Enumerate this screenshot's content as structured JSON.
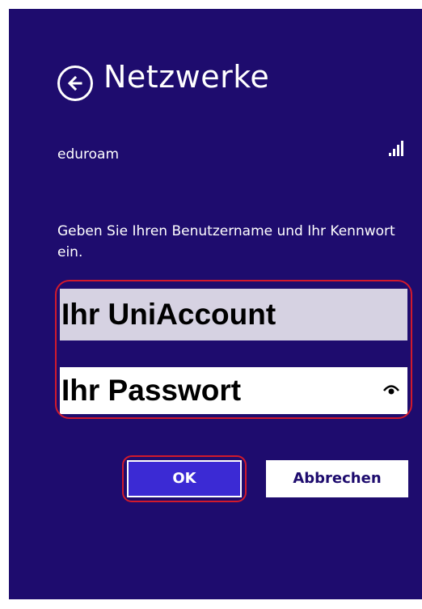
{
  "header": {
    "title": "Netzwerke"
  },
  "network": {
    "name": "eduroam"
  },
  "prompt": {
    "instruction": "Geben Sie Ihren Benutzername und Ihr Kennwort ein."
  },
  "form": {
    "username_value": "Ihr UniAccount",
    "password_value": "Ihr Passwort"
  },
  "buttons": {
    "ok_label": "OK",
    "cancel_label": "Abbrechen"
  },
  "colors": {
    "panel_background": "#1e0c6e",
    "ok_button": "#3b2ad4",
    "highlight": "#d21a2c",
    "username_field": "#d6d2e2"
  },
  "icons": {
    "back": "arrow-left-circle-icon",
    "signal": "wifi-signal-bars-icon",
    "reveal": "password-reveal-eye-icon"
  }
}
